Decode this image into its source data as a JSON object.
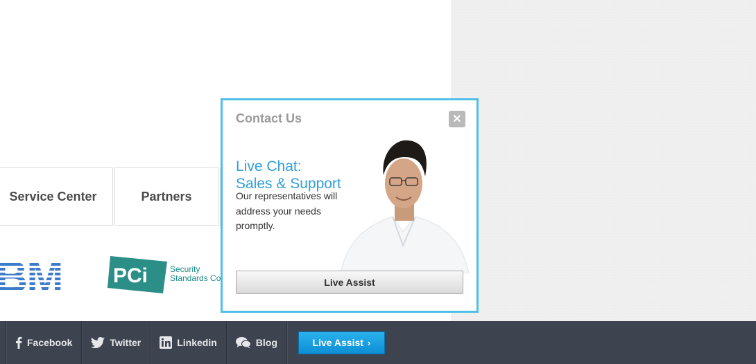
{
  "nav": {
    "tiles": [
      "Service Center",
      "Partners",
      ""
    ]
  },
  "logos": {
    "ibm": "IBM",
    "pci": "PCi",
    "pci_caption_1": "Security",
    "pci_caption_2": "Standards Cou"
  },
  "popup": {
    "title": "Contact Us",
    "close_icon": "close-icon",
    "heading_line1": "Live Chat:",
    "heading_line2": "Sales & Support",
    "body": "Our representatives will address your needs promptly.",
    "button": "Live Assist",
    "accent": "#4fbfe8",
    "heading_color": "#2f9fd8"
  },
  "footer": {
    "background": "#3e4350",
    "social": [
      {
        "label": "Facebook",
        "icon": "facebook-icon"
      },
      {
        "label": "Twitter",
        "icon": "twitter-icon"
      },
      {
        "label": "Linkedin",
        "icon": "linkedin-icon"
      },
      {
        "label": "Blog",
        "icon": "chat-bubbles-icon"
      }
    ],
    "live_assist": "Live Assist",
    "live_assist_arrow": "›",
    "button_color": "#1aa0e2"
  }
}
